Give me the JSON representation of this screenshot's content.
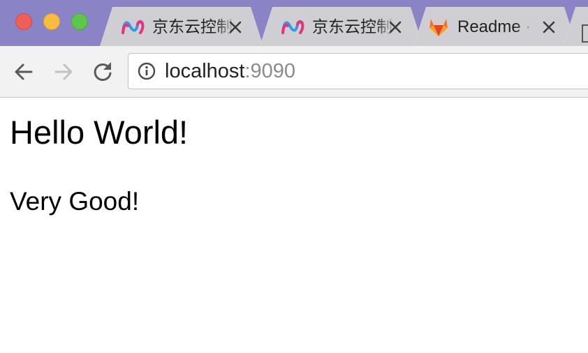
{
  "window": {
    "controls": [
      "close",
      "minimize",
      "maximize"
    ]
  },
  "tabs": [
    {
      "title": "京东云控制台",
      "icon": "jdcloud-logo-icon"
    },
    {
      "title": "京东云控制台",
      "icon": "jdcloud-logo-icon"
    },
    {
      "title": "Readme · ",
      "icon": "gitlab-logo-icon"
    }
  ],
  "toolbar": {
    "address": {
      "host": "localhost",
      "port": ":9090"
    }
  },
  "page": {
    "heading": "Hello World!",
    "subheading": "Very Good!"
  },
  "colors": {
    "tabstrip": "#8a83c6",
    "toolbar": "#f2f2f2",
    "tab": "#cfcfd3",
    "close": "#ee5f57",
    "minimize": "#f8bd3c",
    "maximize": "#5ec649"
  }
}
